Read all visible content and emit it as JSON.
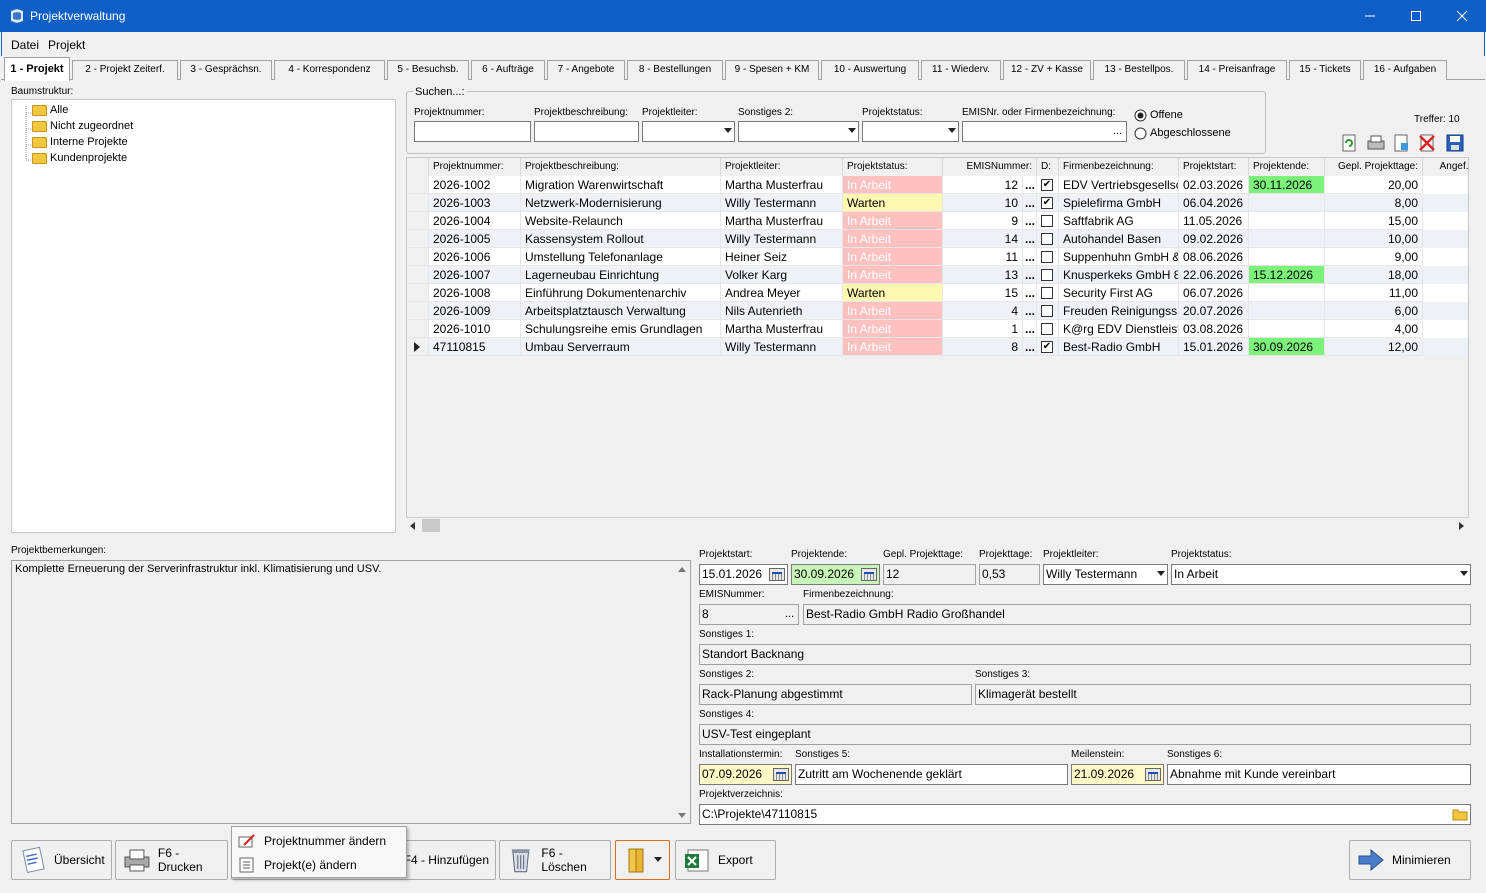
{
  "window": {
    "title": "Projektverwaltung"
  },
  "menu": [
    "Datei",
    "Projekt"
  ],
  "tabs": [
    "1 - Projekt",
    "2 - Projekt Zeiterf.",
    "3 - Gesprächsn.",
    "4 - Korrespondenz",
    "5 - Besuchsb.",
    "6 - Aufträge",
    "7 - Angebote",
    "8 - Bestellungen",
    "9 - Spesen + KM",
    "10 - Auswertung",
    "11 - Wiederv.",
    "12 - ZV + Kasse",
    "13 - Bestellpos.",
    "14 - Preisanfrage",
    "15 - Tickets",
    "16 - Aufgaben"
  ],
  "tree": {
    "label": "Baumstruktur:",
    "nodes": [
      "Alle",
      "Nicht zugeordnet",
      "Interne Projekte",
      "Kundenprojekte"
    ]
  },
  "search": {
    "legend": "Suchen...:",
    "labels": {
      "nummer": "Projektnummer:",
      "beschreibung": "Projektbeschreibung:",
      "leiter": "Projektleiter:",
      "sonstiges2": "Sonstiges 2:",
      "status": "Projektstatus:",
      "emis": "EMISNr. oder Firmenbezeichnung:"
    },
    "radio_open": "Offene",
    "radio_closed": "Abgeschlossene",
    "hits": "Treffer: 10"
  },
  "grid": {
    "headers": [
      "Projektnummer:",
      "Projektbeschreibung:",
      "Projektleiter:",
      "Projektstatus:",
      "EMISNummer:",
      "D:",
      "Firmenbezeichnung:",
      "Projektstart:",
      "Projektende:",
      "Gepl. Projekttage:",
      "Angef. P"
    ],
    "rows": [
      {
        "nr": "2026-1002",
        "desc": "Migration Warenwirtschaft",
        "lead": "Martha Musterfrau",
        "status": "In Arbeit",
        "emis": "12",
        "d": true,
        "firm": "EDV Vertriebsgesellsc",
        "start": "02.03.2026",
        "end": "30.11.2026",
        "days": "20,00"
      },
      {
        "nr": "2026-1003",
        "desc": "Netzwerk-Modernisierung",
        "lead": "Willy Testermann",
        "status": "Warten",
        "emis": "10",
        "d": true,
        "firm": "Spielefirma GmbH",
        "start": "06.04.2026",
        "end": "",
        "days": "8,00"
      },
      {
        "nr": "2026-1004",
        "desc": "Website-Relaunch",
        "lead": "Martha Musterfrau",
        "status": "In Arbeit",
        "emis": "9",
        "d": false,
        "firm": "Saftfabrik AG",
        "start": "11.05.2026",
        "end": "",
        "days": "15,00"
      },
      {
        "nr": "2026-1005",
        "desc": "Kassensystem Rollout",
        "lead": "Willy Testermann",
        "status": "In Arbeit",
        "emis": "14",
        "d": false,
        "firm": "Autohandel Basen",
        "start": "09.02.2026",
        "end": "",
        "days": "10,00"
      },
      {
        "nr": "2026-1006",
        "desc": "Umstellung Telefonanlage",
        "lead": "Heiner Seiz",
        "status": "In Arbeit",
        "emis": "11",
        "d": false,
        "firm": "Suppenhuhn GmbH &",
        "start": "08.06.2026",
        "end": "",
        "days": "9,00"
      },
      {
        "nr": "2026-1007",
        "desc": "Lagerneubau Einrichtung",
        "lead": "Volker Karg",
        "status": "In Arbeit",
        "emis": "13",
        "d": false,
        "firm": "Knusperkeks GmbH 8",
        "start": "22.06.2026",
        "end": "15.12.2026",
        "days": "18,00"
      },
      {
        "nr": "2026-1008",
        "desc": "Einführung Dokumentenarchiv",
        "lead": "Andrea Meyer",
        "status": "Warten",
        "emis": "15",
        "d": false,
        "firm": "Security First AG",
        "start": "06.07.2026",
        "end": "",
        "days": "11,00"
      },
      {
        "nr": "2026-1009",
        "desc": "Arbeitsplatztausch Verwaltung",
        "lead": "Nils Autenrieth",
        "status": "In Arbeit",
        "emis": "4",
        "d": false,
        "firm": "Freuden Reinigungss",
        "start": "20.07.2026",
        "end": "",
        "days": "6,00"
      },
      {
        "nr": "2026-1010",
        "desc": "Schulungsreihe emis Grundlagen",
        "lead": "Martha Musterfrau",
        "status": "In Arbeit",
        "emis": "1",
        "d": false,
        "firm": "K@rg EDV Dienstleist",
        "start": "03.08.2026",
        "end": "",
        "days": "4,00"
      },
      {
        "nr": "47110815",
        "desc": "Umbau Serverraum",
        "lead": "Willy Testermann",
        "status": "In Arbeit",
        "emis": "8",
        "d": true,
        "firm": "Best-Radio GmbH",
        "start": "15.01.2026",
        "end": "30.09.2026",
        "days": "12,00"
      }
    ]
  },
  "notes": {
    "label": "Projektbemerkungen:",
    "text": "Komplette Erneuerung der Serverinfrastruktur inkl. Klimatisierung und USV."
  },
  "detail": {
    "start_label": "Projektstart:",
    "start": "15.01.2026",
    "end_label": "Projektende:",
    "end": "30.09.2026",
    "planned_label": "Gepl. Projekttage:",
    "planned": "12",
    "days_label": "Projekttage:",
    "days": "0,53",
    "lead_label": "Projektleiter:",
    "lead": "Willy Testermann",
    "status_label": "Projektstatus:",
    "status": "In Arbeit",
    "emis_label": "EMISNummer:",
    "emis": "8",
    "firm_label": "Firmenbezeichnung:",
    "firm": "Best-Radio GmbH Radio Großhandel",
    "s1_label": "Sonstiges 1:",
    "s1": "Standort Backnang",
    "s2_label": "Sonstiges 2:",
    "s2": "Rack-Planung abgestimmt",
    "s3_label": "Sonstiges 3:",
    "s3": "Klimagerät bestellt",
    "s4_label": "Sonstiges 4:",
    "s4": "USV-Test eingeplant",
    "install_label": "Installationstermin:",
    "install": "07.09.2026",
    "s5_label": "Sonstiges 5:",
    "s5": "Zutritt am Wochenende geklärt",
    "milestone_label": "Meilenstein:",
    "milestone": "21.09.2026",
    "s6_label": "Sonstiges 6:",
    "s6": "Abnahme mit Kunde vereinbart",
    "dir_label": "Projektverzeichnis:",
    "dir": "C:\\Projekte\\47110815"
  },
  "buttons": {
    "overview": "Übersicht",
    "print": "F6 - Drucken",
    "add": "F4 - Hinzufügen",
    "delete": "F6 - Löschen",
    "export": "Export",
    "minimize": "Minimieren"
  },
  "popup": [
    "Projektnummer ändern",
    "Projekt(e) ändern"
  ]
}
